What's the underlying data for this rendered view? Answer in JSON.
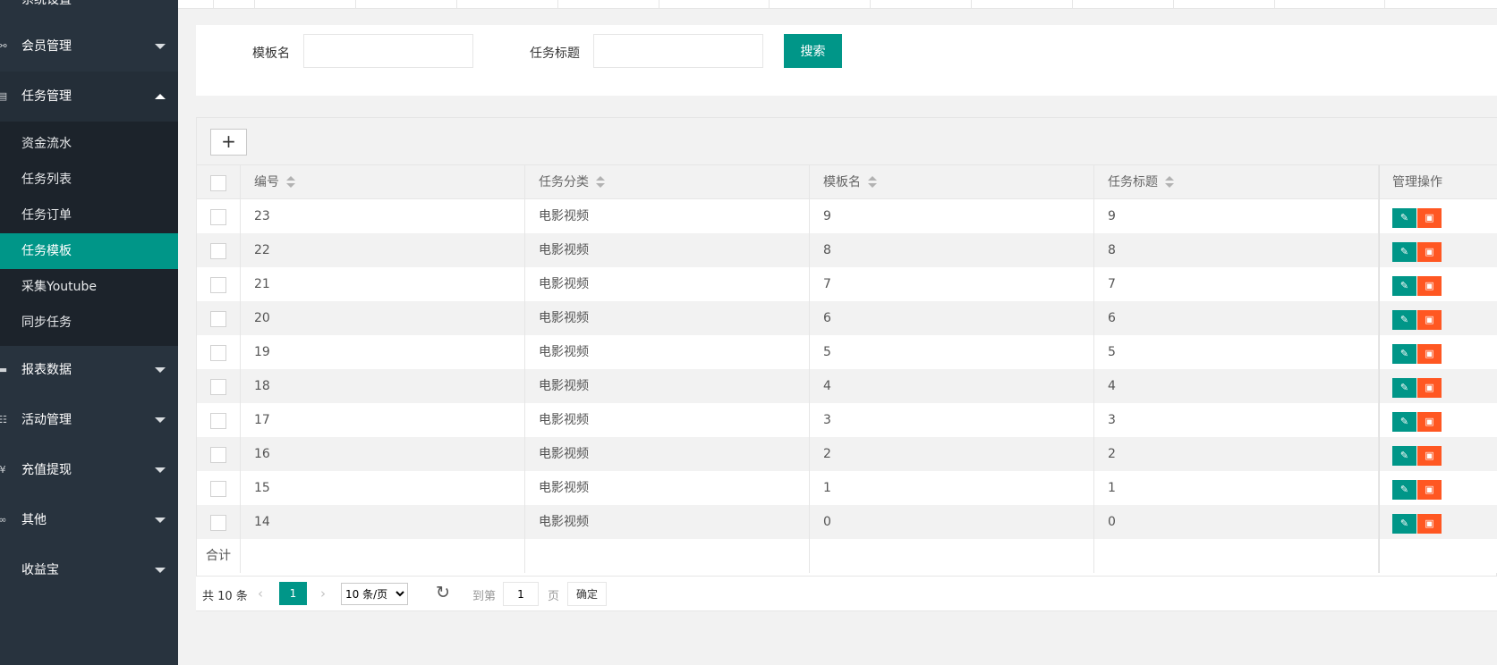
{
  "sidebar": {
    "top_partial": "系统设置",
    "members": "会员管理",
    "tasks": "任务管理",
    "task_children": [
      "资金流水",
      "任务列表",
      "任务订单",
      "任务模板",
      "采集Youtube",
      "同步任务"
    ],
    "active_child": "任务模板",
    "reports": "报表数据",
    "activities": "活动管理",
    "recharge": "充值提现",
    "other": "其他",
    "yield": "收益宝"
  },
  "search": {
    "template_label": "模板名",
    "template_value": "",
    "title_label": "任务标题",
    "title_value": "",
    "button": "搜索"
  },
  "toolbar": {
    "add": "+"
  },
  "table": {
    "headers": {
      "id": "编号",
      "category": "任务分类",
      "template": "模板名",
      "title": "任务标题",
      "actions": "管理操作"
    },
    "rows": [
      {
        "id": "23",
        "category": "电影视频",
        "template": "9",
        "title": "9"
      },
      {
        "id": "22",
        "category": "电影视频",
        "template": "8",
        "title": "8"
      },
      {
        "id": "21",
        "category": "电影视频",
        "template": "7",
        "title": "7"
      },
      {
        "id": "20",
        "category": "电影视频",
        "template": "6",
        "title": "6"
      },
      {
        "id": "19",
        "category": "电影视频",
        "template": "5",
        "title": "5"
      },
      {
        "id": "18",
        "category": "电影视频",
        "template": "4",
        "title": "4"
      },
      {
        "id": "17",
        "category": "电影视频",
        "template": "3",
        "title": "3"
      },
      {
        "id": "16",
        "category": "电影视频",
        "template": "2",
        "title": "2"
      },
      {
        "id": "15",
        "category": "电影视频",
        "template": "1",
        "title": "1"
      },
      {
        "id": "14",
        "category": "电影视频",
        "template": "0",
        "title": "0"
      }
    ],
    "total_label": "合计"
  },
  "pager": {
    "total": "共 10 条",
    "current": "1",
    "page_size": "10 条/页",
    "goto": "到第",
    "goto_value": "1",
    "page": "页",
    "ok": "确定"
  },
  "colors": {
    "accent": "#009688",
    "danger": "#ff5722",
    "sidebar": "#28333e"
  },
  "icons": {
    "members": "user-group-icon",
    "tasks": "document-icon",
    "reports": "reports-icon",
    "activities": "book-icon",
    "recharge": "yen-icon",
    "other": "infinity-icon",
    "edit": "pencil-icon",
    "delete": "trash-icon",
    "refresh": "refresh-icon"
  }
}
